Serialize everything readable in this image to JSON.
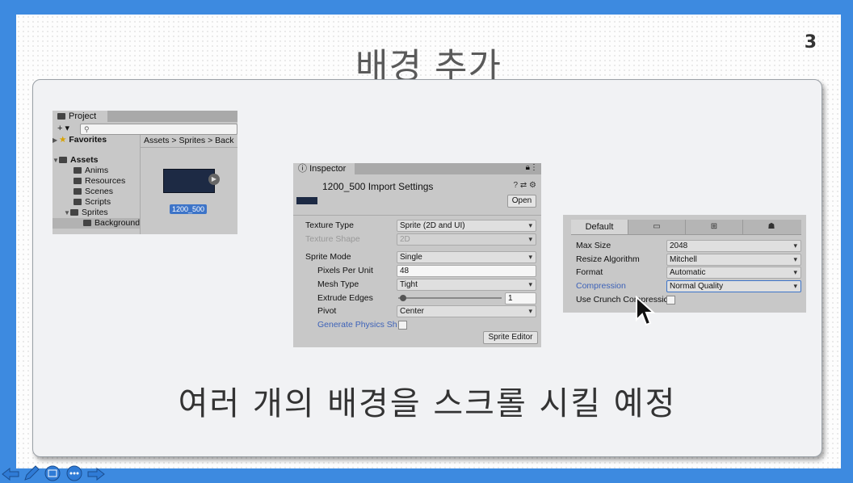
{
  "slide": {
    "title": "배경 추가",
    "page_number": "3",
    "caption": "여러 개의 배경을 스크롤 시킬 예정"
  },
  "project_panel": {
    "tab_label": "Project",
    "add_label": "+ ▾",
    "search_placeholder": "",
    "tree": {
      "favorites": "Favorites",
      "assets": "Assets",
      "anims": "Anims",
      "resources": "Resources",
      "scenes": "Scenes",
      "scripts": "Scripts",
      "sprites": "Sprites",
      "background": "Background"
    },
    "breadcrumb": "Assets > Sprites > Back",
    "asset_label": "1200_500"
  },
  "inspector": {
    "tab_label": "Inspector",
    "title": "1200_500 Import Settings",
    "open_button": "Open",
    "properties": {
      "texture_type_label": "Texture Type",
      "texture_type_value": "Sprite (2D and UI)",
      "texture_shape_label": "Texture Shape",
      "texture_shape_value": "2D",
      "sprite_mode_label": "Sprite Mode",
      "sprite_mode_value": "Single",
      "ppu_label": "Pixels Per Unit",
      "ppu_value": "48",
      "mesh_type_label": "Mesh Type",
      "mesh_type_value": "Tight",
      "extrude_label": "Extrude Edges",
      "extrude_value": "1",
      "pivot_label": "Pivot",
      "pivot_value": "Center",
      "physics_label": "Generate Physics Sh"
    },
    "sprite_editor_button": "Sprite Editor"
  },
  "platform_settings": {
    "tabs": [
      "Default",
      "🖵",
      "⊞",
      "🤖"
    ],
    "max_size_label": "Max Size",
    "max_size_value": "2048",
    "resize_label": "Resize Algorithm",
    "resize_value": "Mitchell",
    "format_label": "Format",
    "format_value": "Automatic",
    "compression_label": "Compression",
    "compression_value": "Normal Quality",
    "crunch_label": "Use Crunch Compressic"
  },
  "colors": {
    "background_blue": "#3d8ae0",
    "link_blue": "#3d62b8"
  }
}
